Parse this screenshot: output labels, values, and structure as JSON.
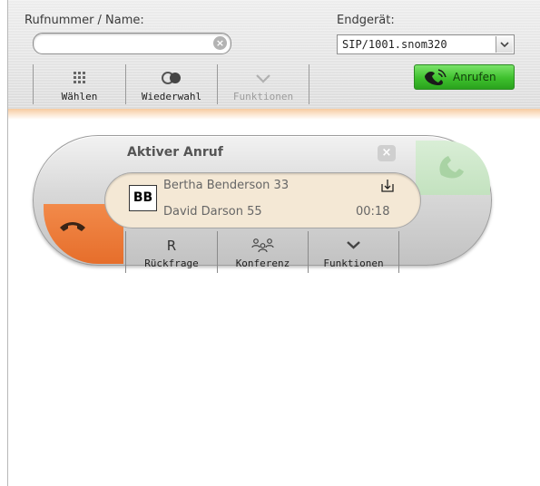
{
  "header": {
    "number_label": "Rufnummer / Name:",
    "device_label": "Endgerät:",
    "search": {
      "value": "",
      "placeholder": ""
    },
    "device_select": {
      "selected": "SIP/1001.snom320"
    }
  },
  "toolbar": {
    "dial_label": "Wählen",
    "redial_label": "Wiederwahl",
    "functions_label": "Funktionen",
    "call_label": "Anrufen"
  },
  "active_call": {
    "title": "Aktiver Anruf",
    "initials": "BB",
    "caller_a": "Bertha Benderson 33",
    "caller_b": "David Darson 55",
    "duration": "00:18",
    "buttons": {
      "consult_glyph": "R",
      "consult_label": "Rückfrage",
      "conference_label": "Konferenz",
      "functions_label": "Funktionen"
    }
  },
  "colors": {
    "call_green": "#3ec02d",
    "hangup_orange": "#e66e2b",
    "answer_green": "#c3e2bf",
    "caller_box": "#f4e8d5"
  },
  "icons": {
    "dial": "keypad-icon",
    "redial": "redial-icon",
    "functions": "chevron-down-icon",
    "call": "phone-icon",
    "transfer": "transfer-icon",
    "conference": "conference-icon",
    "hangup": "hangup-icon",
    "answer": "answer-icon"
  }
}
